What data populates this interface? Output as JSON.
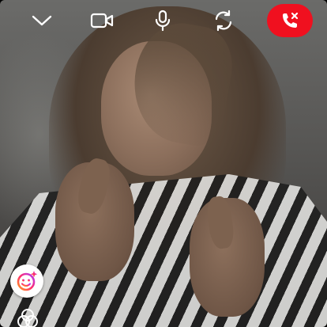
{
  "call": {
    "controls": [
      {
        "id": "minimize",
        "icon": "chevron-down-icon"
      },
      {
        "id": "camera",
        "icon": "video-camera-icon"
      },
      {
        "id": "microphone",
        "icon": "microphone-icon"
      },
      {
        "id": "flip",
        "icon": "flip-camera-icon"
      }
    ],
    "end_call_icon": "end-call-icon",
    "end_call_color": "#f0101f"
  },
  "effects": {
    "face_effects_icon": "face-effects-icon",
    "filters_icon": "filters-icon"
  }
}
